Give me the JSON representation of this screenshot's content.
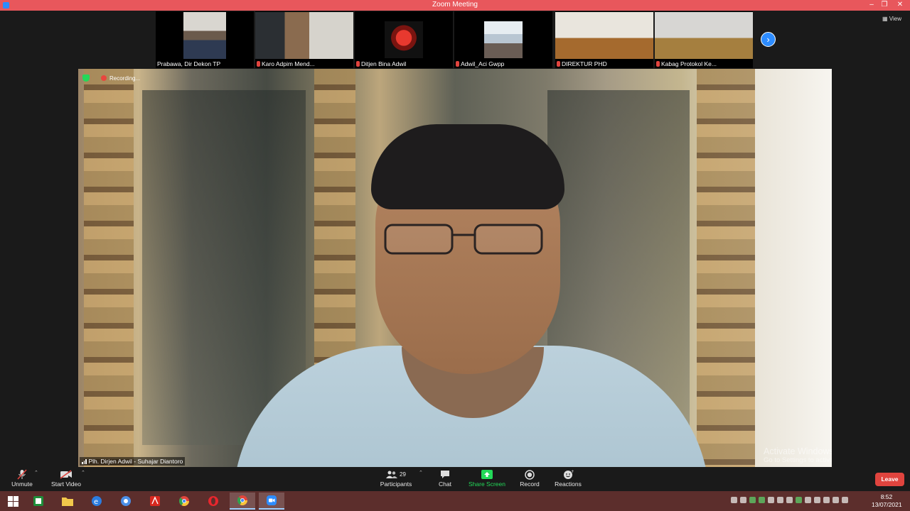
{
  "window": {
    "title": "Zoom Meeting"
  },
  "top_bar": {
    "view_label": "View"
  },
  "participants_strip": [
    {
      "name": "Prabawa, Dir Dekon TP",
      "muted": false
    },
    {
      "name": "Karo Adpim Mend...",
      "muted": true
    },
    {
      "name": "Ditjen Bina Adwil",
      "muted": true
    },
    {
      "name": "Adwil_Aci Gwpp",
      "muted": true
    },
    {
      "name": "DIREKTUR PHD",
      "muted": true
    },
    {
      "name": "Kabag Protokol Ke...",
      "muted": true
    }
  ],
  "main_video": {
    "recording_label": "Recording...",
    "speaker_name": "Plh. Dirjen Adwil - Suhajar Diantoro",
    "watermark_line1": "Activate Windows",
    "watermark_line2": "Go to Settings to activate Windows."
  },
  "toolbar": {
    "unmute": "Unmute",
    "start_video": "Start Video",
    "participants": "Participants",
    "participants_count": "29",
    "chat": "Chat",
    "share_screen": "Share Screen",
    "record": "Record",
    "reactions": "Reactions",
    "leave": "Leave"
  },
  "colors": {
    "title_bar": "#e8575c",
    "accent_blue": "#2d8cff",
    "share_green": "#23d959",
    "leave_red": "#e0443e",
    "taskbar": "#5c2e2c"
  },
  "taskbar": {
    "apps": [
      "windows-start-icon",
      "office-icon",
      "file-explorer-icon",
      "edge-icon",
      "chrome-icon",
      "acrobat-icon",
      "chrome-icon",
      "opera-icon",
      "chrome-icon",
      "zoom-icon"
    ],
    "time": "8:52",
    "date": "13/07/2021"
  }
}
